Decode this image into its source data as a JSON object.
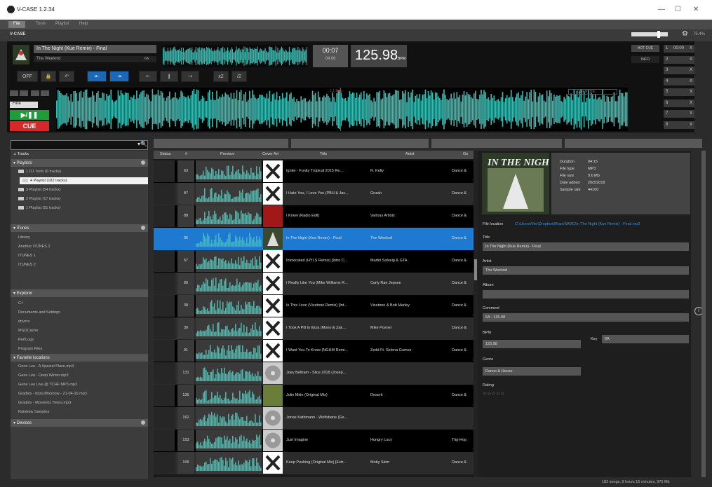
{
  "window": {
    "title": "V-CASE 1.2.34",
    "minimize": "—",
    "maximize": "☐",
    "close": "✕"
  },
  "menu": [
    "File",
    "Tools",
    "Playlist",
    "Help"
  ],
  "toolbar": {
    "logo_text": "V-CASE",
    "volume_value": "75.4%",
    "volume_level": 0.78
  },
  "deck": {
    "title": "In The Night (Kue Remix) - Final",
    "artist": "The Weeknd",
    "artist_tag": "6A",
    "time_top": "00:07",
    "time_bottom": "04:06",
    "bpm": "125.98",
    "bpm_unit": "BPM",
    "controls": [
      "OFF",
      "🔒",
      "↶",
      "⇤",
      "⇥",
      "⇠",
      "❙",
      "⇢",
      "x2",
      "/2"
    ],
    "beat_label": "1.1 Bars",
    "fine_label": "Fine",
    "play_label": "▶/❚❚",
    "cue_label": "CUE",
    "quantize_label": "QUANTIZE"
  },
  "hotcues": {
    "head_left": "HOT CUE",
    "head_sub": "INFO",
    "items": [
      {
        "n": "1",
        "v": "00:00"
      },
      {
        "n": "2",
        "v": ""
      },
      {
        "n": "3",
        "v": ""
      },
      {
        "n": "4",
        "v": ""
      },
      {
        "n": "5",
        "v": ""
      },
      {
        "n": "6",
        "v": ""
      },
      {
        "n": "7",
        "v": ""
      },
      {
        "n": "8",
        "v": ""
      }
    ]
  },
  "tree": {
    "tracks": "Tracks",
    "playlists": "Playlists",
    "playlist_items": [
      "1 DJ Tools (6 tracks)",
      "4 Playlist (182 tracks)",
      "3 Playlist (54 tracks)",
      "2 Playlist (17 tracks)",
      "1 Playlist (51 tracks)"
    ],
    "itunes": "iTunes",
    "itunes_items": [
      "Library",
      "Another ITUNES 2",
      "ITUNES 1",
      "ITUNES 2"
    ],
    "explorer": "Explorer",
    "explorer_items": [
      "C:\\",
      "Documents and Settings",
      "drivers",
      "MSOCache",
      "PerfLogs",
      "Program Files"
    ],
    "favorites": "Favorite locations",
    "favorite_items": [
      "Gene Lee - A Special Place.mp3",
      "Gene Lee - Deep Winter.mp3",
      "Gene Lee Live @ TCHF MP3.mp3",
      "Gradies - Ibiza Mixshow - 21-04-16.mp3",
      "Gradies - Moments Times.mp3",
      "Rainbow Samples"
    ],
    "devices": "Devices"
  },
  "table": {
    "headers": [
      "Status",
      "#",
      "Preview",
      "Cover Art",
      "Title",
      "Artist",
      "Ge"
    ],
    "rows": [
      {
        "num": "63",
        "title": "Ignite - Funky Tropical 2015 Re...",
        "artist": "R. Kelly",
        "genre": "Dance &",
        "cover": "x"
      },
      {
        "num": "87",
        "title": "I Hate You, I Love You (PBH & Jac...",
        "artist": "Gnash",
        "genre": "Dance &",
        "cover": "x"
      },
      {
        "num": "88",
        "title": "I Knew (Radio Edit)",
        "artist": "Various Artists",
        "genre": "Dance &",
        "cover": "red"
      },
      {
        "num": "95",
        "title": "In The Night (Kue Remix) - Final",
        "artist": "The Weeknd",
        "genre": "Dance &",
        "cover": "art",
        "selected": true
      },
      {
        "num": "57",
        "title": "Intoxicated (HYLS Remix) [Intro C...",
        "artist": "Martin Solveig & GTA",
        "genre": "Dance &",
        "cover": "x"
      },
      {
        "num": "89",
        "title": "I Really Like You (Mike Williams R...",
        "artist": "Carly Rae Jepsen",
        "genre": "Dance &",
        "cover": "x"
      },
      {
        "num": "38",
        "title": "Is This Love (Vicetone Remix) [Int...",
        "artist": "Vicetone & Bob Marley",
        "genre": "Dance &",
        "cover": "x"
      },
      {
        "num": "30",
        "title": "I Took A Pill In Ibiza (Mono & Zak...",
        "artist": "Mike Posner",
        "genre": "Dance &",
        "cover": "x"
      },
      {
        "num": "91",
        "title": "I Want You To Know (NGHM Remi...",
        "artist": "Zedd Ft. Selena Gomez",
        "genre": "Dance &",
        "cover": "x"
      },
      {
        "num": "131",
        "title": "Joey Beltram - Slice 2018 (Josep...",
        "artist": "",
        "genre": "",
        "cover": "disc"
      },
      {
        "num": "135",
        "title": "Jolie Mitie (Original Mix)",
        "artist": "Deserit",
        "genre": "Dance &",
        "cover": "photo"
      },
      {
        "num": "162",
        "title": "Jonas Kathmann - Wolfsbane (Gs...",
        "artist": "",
        "genre": "",
        "cover": "disc"
      },
      {
        "num": "153",
        "title": "Just Imagine",
        "artist": "Hungry Lucy",
        "genre": "Trip-Hop",
        "cover": "disc"
      },
      {
        "num": "109",
        "title": "Keep Pushing (Original Mix) [Extr...",
        "artist": "Moby Skim",
        "genre": "Dance &",
        "cover": "x"
      }
    ]
  },
  "info": {
    "meta": [
      {
        "k": "Duration",
        "v": "04:15"
      },
      {
        "k": "File type",
        "v": "MP3"
      },
      {
        "k": "File size",
        "v": "9.6 Mb"
      },
      {
        "k": "Date added",
        "v": "20/3/2018"
      },
      {
        "k": "Sample rate",
        "v": "44100"
      }
    ],
    "file_location_label": "File location",
    "file_location": "C:\\Users\\Vito\\Dropbox\\Music\\WMC\\In The Night (Kue Remix) - Final.mp3",
    "title_label": "Title",
    "title": "In The Night (Kue Remix) - Final",
    "artist_label": "Artist",
    "artist": "The Weeknd",
    "album_label": "Album",
    "album": "",
    "comment_label": "Comment",
    "comment": "6A - 125.98",
    "bpm_label": "BPM",
    "bpm": "125.98",
    "key_label": "Key",
    "key": "6A",
    "genre_label": "Genre",
    "genre": "Dance & House",
    "rating_label": "Rating",
    "rating": "☆☆☆☆☆",
    "info_btn": "i"
  },
  "status": "182 songs, 8 hours 15 minutes, 975 Mb",
  "colors": {
    "accent": "#1e7ad0",
    "play": "#1f9b3a",
    "cue": "#d62828",
    "wave": "#3fb8b0"
  }
}
